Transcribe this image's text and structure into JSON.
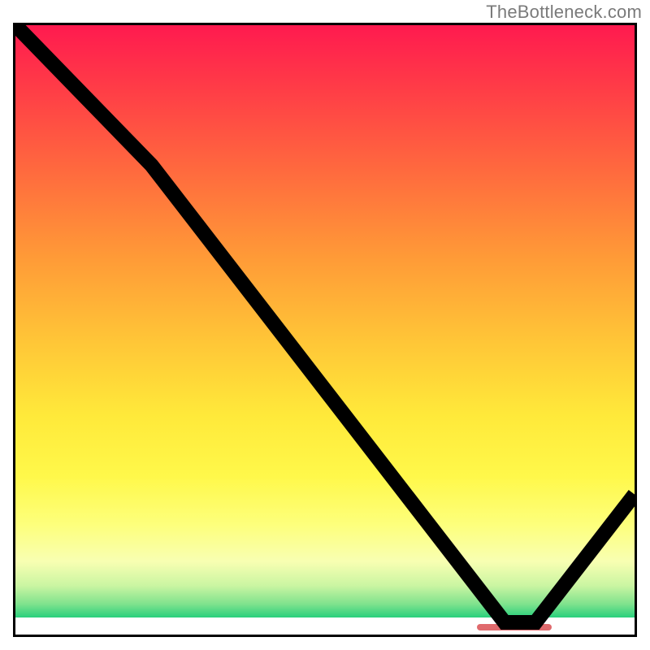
{
  "attribution": "TheBottleneck.com",
  "colors": {
    "gradient_top": "#ff1a4f",
    "gradient_mid": "#ffe93a",
    "gradient_bottom": "#29d07d",
    "marker": "#e06a6d",
    "curve_stroke": "#000000"
  },
  "chart_data": {
    "type": "line",
    "title": "",
    "xlabel": "",
    "ylabel": "",
    "xlim": [
      0,
      100
    ],
    "ylim": [
      0,
      100
    ],
    "grid": false,
    "legend": false,
    "x": [
      0,
      22,
      79,
      84,
      100
    ],
    "values": [
      100,
      77,
      2,
      2,
      23
    ],
    "annotations": [
      {
        "kind": "flat-marker",
        "x_start": 74,
        "x_end": 86,
        "y": 2
      }
    ],
    "background": "red-yellow-green vertical heat gradient with thin white baseline band"
  }
}
